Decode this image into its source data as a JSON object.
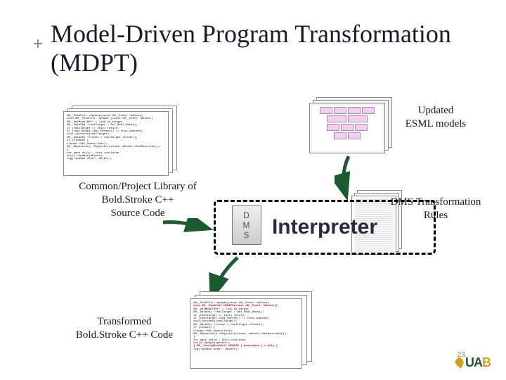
{
  "title": "Model-Driven Program Transformation (MDPT)",
  "labels": {
    "updated_models": "Updated\nESML models",
    "common_lib": "Common/Project Library of\nBold.Stroke C++\nSource Code",
    "dms_rules": "DMS Transformation\nRules",
    "transformed": "Transformed\nBold.Stroke C++ Code"
  },
  "interp": "Interpreter",
  "dms": "D\nM\nS",
  "slide_number": "23",
  "logo_letters": {
    "u": "U",
    "a": "A",
    "b": "B"
  },
  "code_snippet": {
    "lines": [
      "UM__PushPull::Update(const UM__Event *aEvent)",
      "void UM__PushPull::Update (const UM__Event *aEvent)",
      "UM__GetModelRef* = link_to_target",
      "UM__DataObj *realTarget = Get_Real_Data();",
      "if (realTarget == this) return;",
      "if (realTarget->Get_Parent() != this->parent)",
      "   this->process(realTarget);",
      "UM__DataObj *cloned = realTarget->Clone();",
      "if (cloned) {",
      "   cloned->Set_Owner(this);",
      "   UM__Repository::Register(cloned, aEvent->GetSourceId());",
      "}",
      "for each child : this->children",
      "   child->Update(aEvent);",
      "log(\"update done\", aEvent);"
    ],
    "hl1": "void UM__PushPull_UPDATE(const UM__Event *aEvent){",
    "hl2": "} UM__ConfigPushPull_UPDATE  { push(data_) = dels_}"
  }
}
